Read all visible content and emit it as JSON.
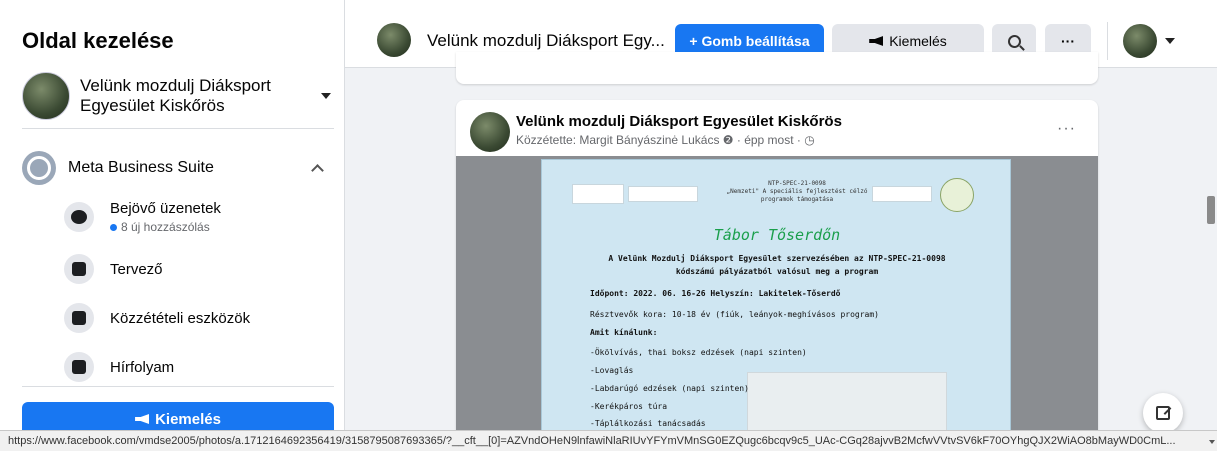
{
  "sidebar": {
    "title": "Oldal kezelése",
    "page_name": "Velünk mozdulj Diáksport Egyesület Kiskőrös",
    "section": "Meta Business Suite",
    "items": [
      {
        "label": "Bejövő üzenetek",
        "sub": "8 új hozzászólás"
      },
      {
        "label": "Tervező"
      },
      {
        "label": "Közzétételi eszközök"
      },
      {
        "label": "Hírfolyam"
      }
    ],
    "boost_label": "Kiemelés"
  },
  "header": {
    "page_title": "Velünk mozdulj Diáksport Egy...",
    "setup_button": "+ Gomb beállítása",
    "boost_button": "Kiemelés",
    "more": "···"
  },
  "post": {
    "author": "Velünk mozdulj Diáksport Egyesület Kiskőrös",
    "meta": "Közzétette: Margit Bányászinė Lukács ❷ · épp most · ◷",
    "more": "···",
    "flyer": {
      "ntp_lines": [
        "NTP-SPEC-21-0098",
        "„Nemzeti\" A speciális fejlesztést célzó",
        "programok támogatása"
      ],
      "title": "Tábor Tőserdőn",
      "intro_1": "A Velünk Mozdulj Diáksport Egyesület szervezésében az NTP-SPEC-21-0098",
      "intro_2": "kódszámú pályázatból valósul meg a program",
      "date_line": "Időpont: 2022. 06. 16-26    Helyszín: Lakitelek-Tőserdő",
      "age_line": "Résztvevők kora: 10-18 év (fiúk, leányok-meghívásos program)",
      "offer_heading": "Amit kínálunk:",
      "offers": [
        "-Ökölvívás, thai boksz edzések (napi szinten)",
        "-Lovaglás",
        "-Labdarúgó edzések (napi szinten)",
        "-Kerékpáros túra",
        "-Táplálkozási tanácsadás"
      ]
    }
  },
  "status_url": "https://www.facebook.com/vmdse2005/photos/a.1712164692356419/3158795087693365/?__cft__[0]=AZVndOHeN9lnfawiNlaRIUvYFYmVMnSG0EZQugc6bcqv9c5_UAc-CGq28ajvvB2McfwVVtvSV6kF70OYhgQJX2WiAO8bMayWD0CmL..."
}
